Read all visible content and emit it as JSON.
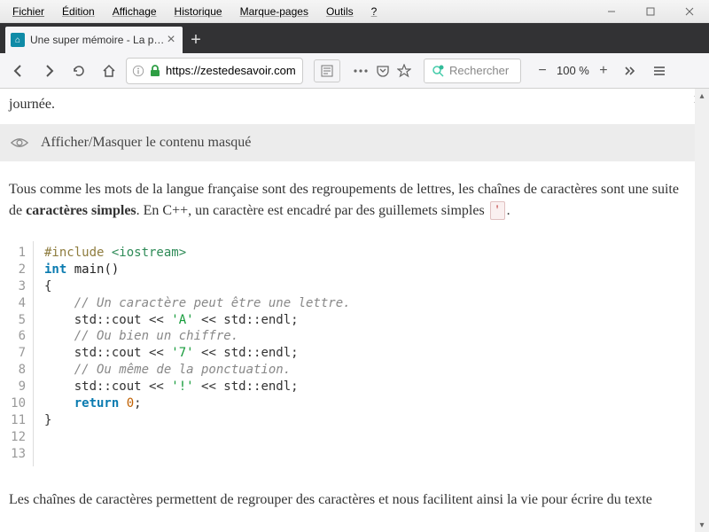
{
  "menu": {
    "file": "Fichier",
    "edit": "Édition",
    "view": "Affichage",
    "history": "Historique",
    "bookmarks": "Marque-pages",
    "tools": "Outils",
    "help": "?"
  },
  "tab": {
    "title": "Une super mémoire - La progr…"
  },
  "addr": {
    "url": "https://zestedesavoir.com"
  },
  "search": {
    "placeholder": "Rechercher"
  },
  "zoom": {
    "level": "100 %"
  },
  "content": {
    "top_fragment": "journée.",
    "spoiler_label": "Afficher/Masquer le contenu masqué",
    "para_a": "Tous comme les mots de la langue française sont des regroupements de lettres, les chaînes de caractères sont une suite de ",
    "para_b": "caractères simples",
    "para_c": ". En C++, un caractère est encadré par des guillemets simples ",
    "quote_char": "'",
    "para_d": ".",
    "after": "Les chaînes de caractères permettent de regrouper des caractères et nous facilitent ainsi la vie pour écrire du texte"
  },
  "code": {
    "include_a": "#include ",
    "include_b": "<iostream>",
    "kw_int": "int",
    "main": " main()",
    "brace_o": "{",
    "cmt1": "    // Un caractère peut être une lettre.",
    "cout": "    std::cout << ",
    "ch1": "'A'",
    "endl": " << std::endl;",
    "cmt2": "    // Ou bien un chiffre.",
    "ch2": "'7'",
    "cmt3": "    // Ou même de la ponctuation.",
    "ch3": "'!'",
    "blank": "",
    "ret_indent": "    ",
    "ret": "return ",
    "zero": "0",
    "semi": ";",
    "brace_c": "}",
    "lines": [
      "1",
      "2",
      "3",
      "4",
      "5",
      "6",
      "7",
      "8",
      "9",
      "10",
      "11",
      "12",
      "13"
    ]
  }
}
